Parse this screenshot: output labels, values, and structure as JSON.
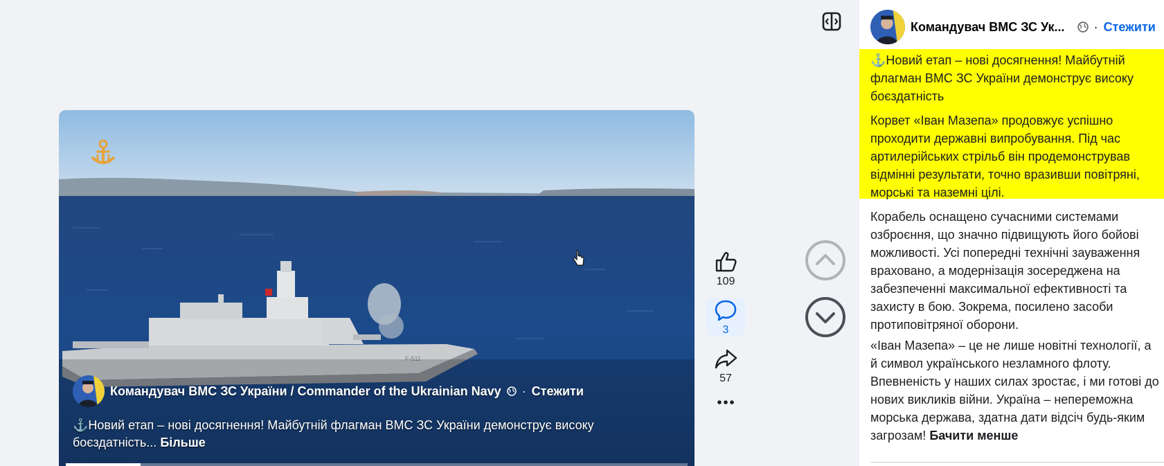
{
  "page": {
    "author": "Командувач ВМС ЗС України / Commander of the Ukrainian Navy",
    "author_short": "Командувач ВМС ЗС Ук...",
    "follow": "Стежити",
    "dot_separator": "·",
    "privacy_icon": "globe-icon"
  },
  "video": {
    "caption": "⚓Новий етап – нові досягнення! Майбутній флагман ВМС ЗС України демонструє високу боєздатність...",
    "more_label": "Більше",
    "hull_number": "F-511",
    "progress_percent": 12
  },
  "actions": {
    "likes": "109",
    "comments": "3",
    "shares": "57",
    "accent": "#0a66e4"
  },
  "post": {
    "headline": "⚓Новий етап – нові досягнення! Майбутній флагман ВМС ЗС України демонструє високу боєздатність",
    "p1": "Корвет «Іван Мазепа» продовжує успішно проходити державні випробування. Під час артилерійських стрільб він продемонстрував відмінні результати, точно вразивши повітряні, морські та наземні цілі.",
    "p2": "Корабель оснащено сучасними системами озброєння, що значно підвищують його бойові можливості. Усі попередні технічні зауваження враховано, а модернізація зосереджена на забезпеченні максимальної ефективності та захисту в бою. Зокрема, посилено засоби протиповітряної оборони.",
    "p3": "«Іван Мазепа» – це не лише новітні технології, а й символ українського незламного флоту. Впевненість у наших силах зростає, і ми готові до нових викликів війни. Україна – непереможна морська держава, здатна дати відсіч будь-яким загрозам!",
    "see_less": "Бачити менше",
    "highlight_color": "#ffff00"
  }
}
